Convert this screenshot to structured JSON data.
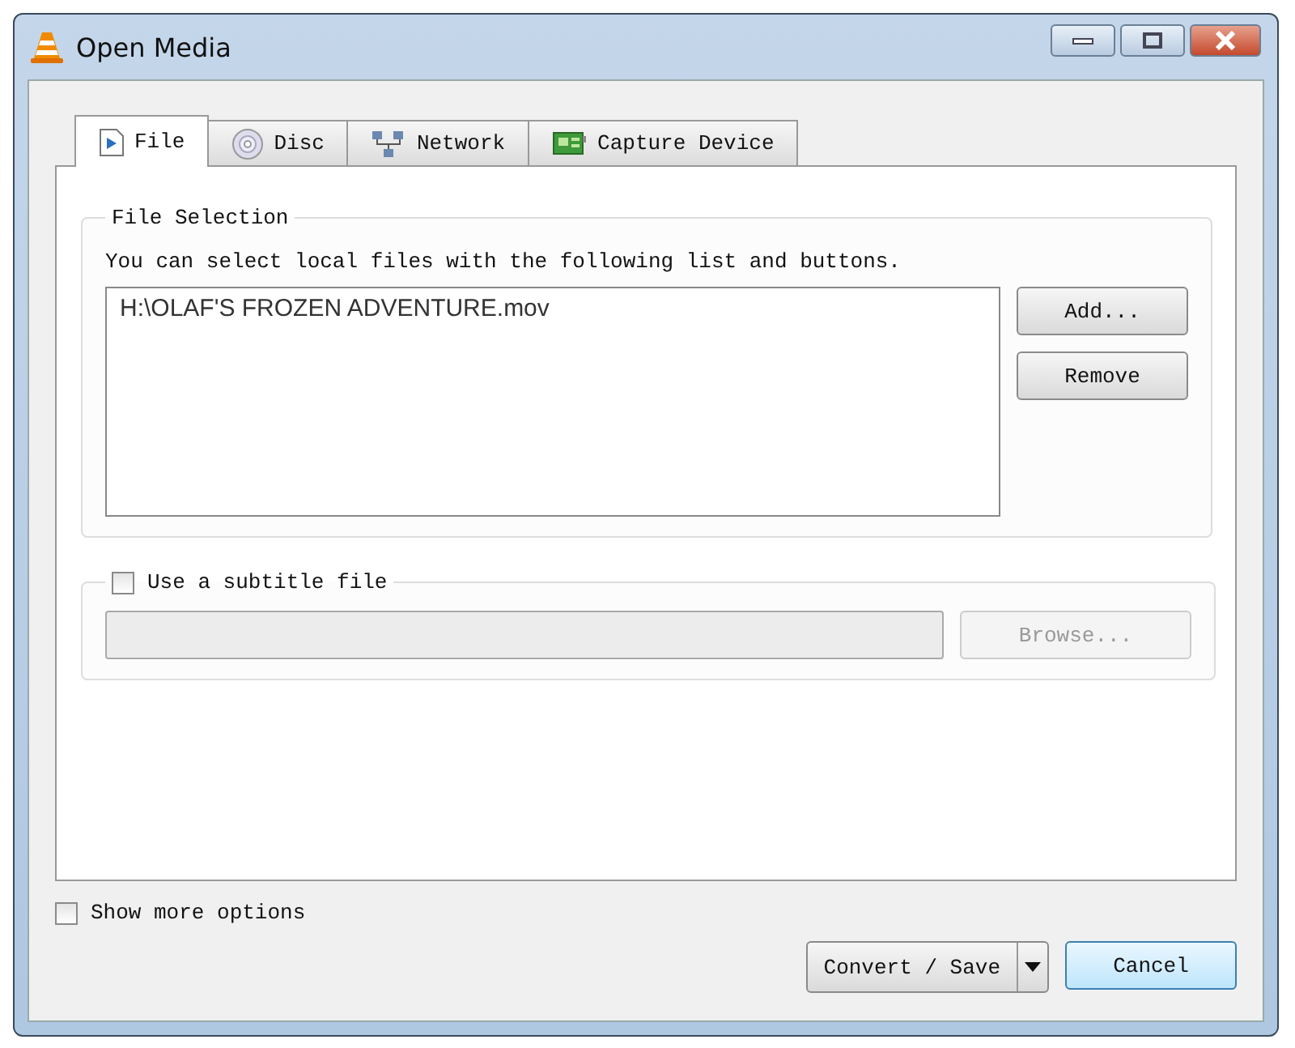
{
  "window": {
    "title": "Open Media"
  },
  "tabs": [
    {
      "label": "File",
      "kind": "file",
      "selected": true
    },
    {
      "label": "Disc",
      "kind": "disc",
      "selected": false
    },
    {
      "label": "Network",
      "kind": "network",
      "selected": false
    },
    {
      "label": "Capture Device",
      "kind": "capture",
      "selected": false
    }
  ],
  "file_selection": {
    "title": "File Selection",
    "hint": "You can select local files with the following list and buttons.",
    "files": [
      "H:\\OLAF'S FROZEN ADVENTURE.mov"
    ],
    "buttons": [
      {
        "label": "Add...",
        "disabled": false
      },
      {
        "label": "Remove",
        "disabled": false
      }
    ]
  },
  "subtitle": {
    "label": "Use a subtitle file",
    "checked": false,
    "field_disabled": true,
    "browse": {
      "label": "Browse...",
      "disabled": true
    }
  },
  "show_more_options": {
    "label": "Show more options",
    "checked": false
  },
  "buttons": {
    "convert": "Convert / Save",
    "cancel": "Cancel"
  }
}
